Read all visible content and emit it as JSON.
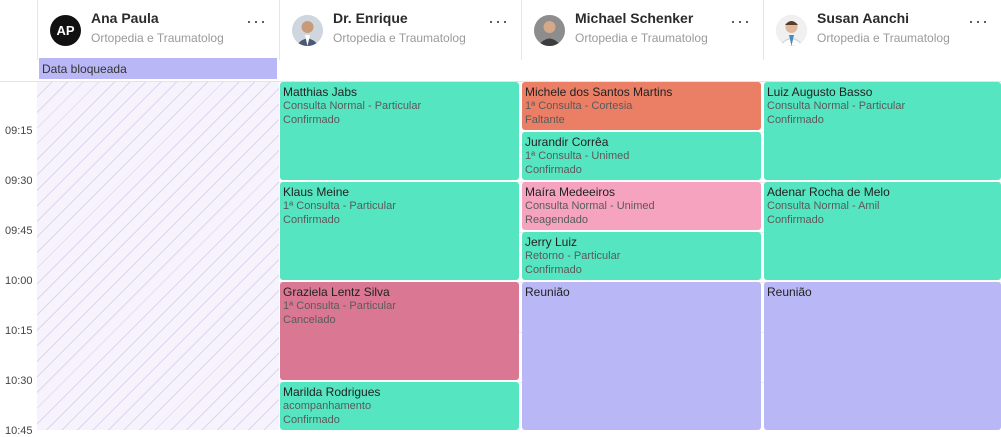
{
  "doctors": [
    {
      "name": "Ana Paula",
      "specialty": "Ortopedia e Traumatologia",
      "initials": "AP",
      "more": "···"
    },
    {
      "name": "Dr. Enrique",
      "specialty": "Ortopedia e Traumatologia",
      "more": "···"
    },
    {
      "name": "Michael Schenker",
      "specialty": "Ortopedia e Traumatologia",
      "more": "···"
    },
    {
      "name": "Susan Aanchi",
      "specialty": "Ortopedia e Traumatologia",
      "more": "···"
    }
  ],
  "times": [
    "09:15",
    "09:30",
    "09:45",
    "10:00",
    "10:15",
    "10:30",
    "10:45"
  ],
  "blocked_label": "Data bloqueada",
  "colors": {
    "green": "#55e6c1",
    "orange": "#ea7f65",
    "pink": "#f5a3bf",
    "red": "#da7894",
    "purple": "#b9b7f5",
    "blocked": "#b9b7f5"
  },
  "col1": [
    {
      "name": "Matthias Jabs",
      "type": "Consulta Normal - Particular",
      "status": "Confirmado"
    },
    {
      "name": "Klaus Meine",
      "type": "1ª Consulta - Particular",
      "status": "Confirmado"
    },
    {
      "name": "Graziela Lentz Silva",
      "type": "1ª Consulta - Particular",
      "status": "Cancelado"
    },
    {
      "name": "Marilda Rodrigues",
      "type": "acompanhamento",
      "status": "Confirmado"
    }
  ],
  "col2": [
    {
      "name": "Michele dos Santos Martins",
      "type": "1ª Consulta - Cortesia",
      "status": "Faltante"
    },
    {
      "name": "Jurandir Corrêa",
      "type": "1ª Consulta - Unimed",
      "status": "Confirmado"
    },
    {
      "name": "Maíra Medeeiros",
      "type": "Consulta Normal - Unimed",
      "status": "Reagendado"
    },
    {
      "name": "Jerry Luiz",
      "type": "Retorno - Particular",
      "status": "Confirmado"
    },
    {
      "name": "Reunião"
    }
  ],
  "col3": [
    {
      "name": "Luiz Augusto Basso",
      "type": "Consulta Normal - Particular",
      "status": "Confirmado"
    },
    {
      "name": "Adenar Rocha de Melo",
      "type": "Consulta Normal - Amil",
      "status": "Confirmado"
    },
    {
      "name": "Reunião"
    }
  ]
}
